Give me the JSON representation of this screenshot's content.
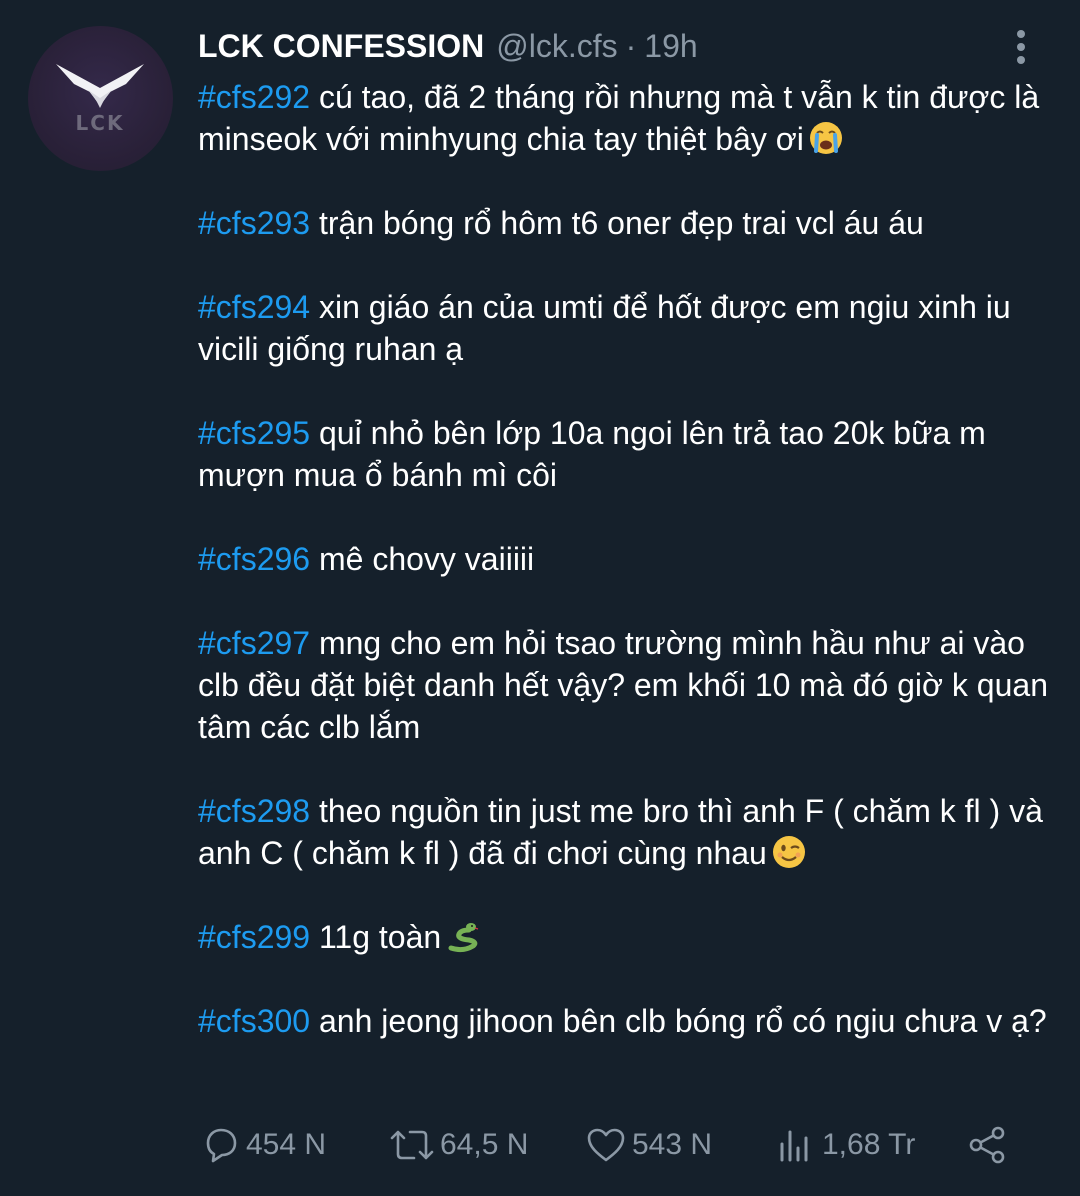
{
  "tweet": {
    "author_name": "LCK CONFESSION",
    "handle": "@lck.cfs",
    "separator": "·",
    "time": "19h",
    "avatar_text": "LCK",
    "entries": [
      {
        "tag": "#cfs292",
        "text": " cú tao, đã 2 tháng rồi nhưng mà t vẫn k tin được là minseok với minhyung chia tay thiệt bây ơi",
        "emoji": "loudly-crying-face"
      },
      {
        "tag": "#cfs293",
        "text": " trận bóng rổ hôm t6 oner đẹp trai vcl áu áu",
        "emoji": ""
      },
      {
        "tag": "#cfs294",
        "text": " xin giáo án của umti để hốt được em ngiu xinh iu vicili giống ruhan ạ",
        "emoji": ""
      },
      {
        "tag": "#cfs295",
        "text": " quỉ nhỏ bên lớp 10a ngoi lên trả tao 20k bữa m mượn mua ổ bánh mì côi",
        "emoji": ""
      },
      {
        "tag": "#cfs296",
        "text": " mê chovy vaiiiii",
        "emoji": ""
      },
      {
        "tag": "#cfs297",
        "text": " mng cho em hỏi tsao trường mình hầu như ai vào clb đều đặt biệt danh hết vậy? em khối 10 mà đó giờ k quan tâm các clb lắm",
        "emoji": ""
      },
      {
        "tag": "#cfs298",
        "text": " theo nguồn tin just me bro thì anh F ( chăm k fl ) và anh C ( chăm k fl ) đã đi chơi cùng nhau",
        "emoji": "winking-face"
      },
      {
        "tag": "#cfs299",
        "text": " 11g toàn",
        "emoji": "snake"
      },
      {
        "tag": "#cfs300",
        "text": " anh jeong jihoon bên clb bóng rổ có ngiu chưa v ạ?",
        "emoji": ""
      }
    ],
    "actions": {
      "reply_count": "454 N",
      "retweet_count": "64,5 N",
      "like_count": "543 N",
      "view_count": "1,68 Tr"
    }
  },
  "colors": {
    "background": "#15202b",
    "hashtag": "#1d9bf0",
    "secondary_text": "#8b98a5",
    "avatar_bg": "#2a2139"
  },
  "icons": [
    "more-options-icon",
    "reply-icon",
    "retweet-icon",
    "like-icon",
    "views-icon",
    "share-icon"
  ]
}
